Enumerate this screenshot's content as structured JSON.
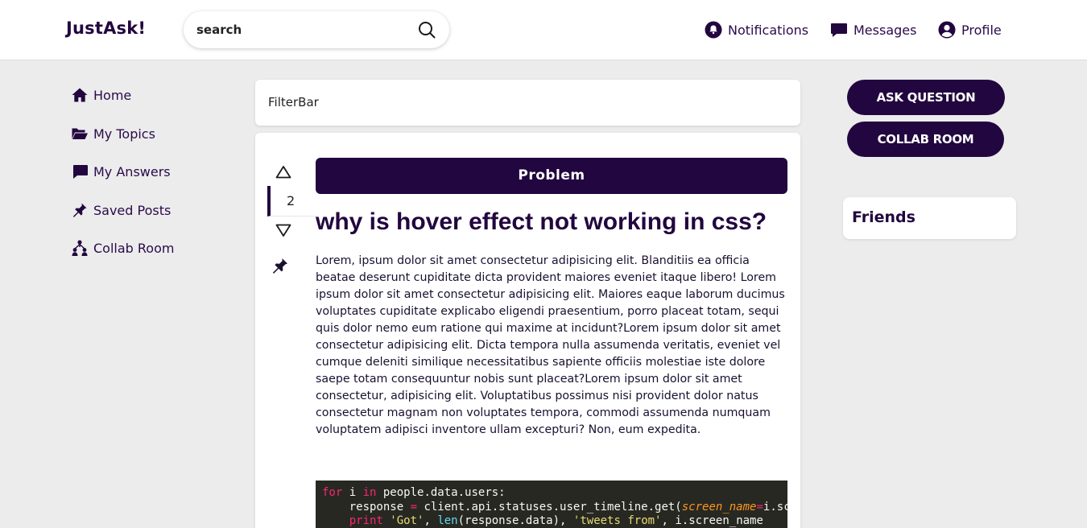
{
  "header": {
    "brand": "JustAsk!",
    "search_placeholder": "search",
    "nav": {
      "notifications": "Notifications",
      "messages": "Messages",
      "profile": "Profile"
    }
  },
  "sidebar": {
    "items": [
      {
        "label": "Home",
        "icon": "home-icon"
      },
      {
        "label": "My Topics",
        "icon": "folder-open-icon"
      },
      {
        "label": "My Answers",
        "icon": "chat-bubble-icon"
      },
      {
        "label": "Saved Posts",
        "icon": "pin-icon"
      },
      {
        "label": "Collab Room",
        "icon": "people-network-icon"
      }
    ]
  },
  "filterbar": {
    "label": "FilterBar"
  },
  "post": {
    "vote_count": "2",
    "tag": "Problem",
    "title": "why is hover effect not working in css?",
    "body": "Lorem, ipsum dolor sit amet consectetur adipisicing elit. Blanditiis ea officia beatae deserunt cupiditate dicta provident maiores eveniet itaque libero! Lorem ipsum dolor sit amet consectetur adipisicing elit. Maiores eaque laborum ducimus voluptates cupiditate explicabo eligendi praesentium, porro placeat totam, sequi quis dolor nemo eum ratione qui maxime at incidunt?Lorem ipsum dolor sit amet consectetur adipisicing elit. Dicta tempora nulla assumenda veritatis, eveniet vel cumque deleniti similique necessitatibus sapiente officiis molestiae iste dolore saepe totam consequuntur nobis sunt placeat?Lorem ipsum dolor sit amet consectetur, adipisicing elit. Voluptatibus possimus nisi provident dolor natus consectetur magnam non voluptates tempora, commodi assumenda numquam voluptatem adipisci inventore ullam excepturi? Non, eum expedita.",
    "code": {
      "line1": {
        "kw1": "for",
        "t1": " i ",
        "kw2": "in",
        "t2": " people.data.users:"
      },
      "line2": {
        "t1": "    response ",
        "op": "=",
        "t2": " client.api.statuses.user_timeline.get(",
        "param": "screen_name",
        "op2": "=",
        "t3": "i.scree"
      },
      "line3": {
        "kw": "    print",
        "t1": " ",
        "s1": "'Got'",
        "t2": ", ",
        "fn": "len",
        "t3": "(response.data), ",
        "s2": "'tweets from'",
        "t4": ", i.screen_name"
      }
    }
  },
  "right": {
    "ask_button": "ASK QUESTION",
    "collab_button": "COLLAB ROOM",
    "friends_title": "Friends"
  },
  "colors": {
    "accent": "#22063f",
    "background": "#ececec",
    "card": "#ffffff"
  }
}
